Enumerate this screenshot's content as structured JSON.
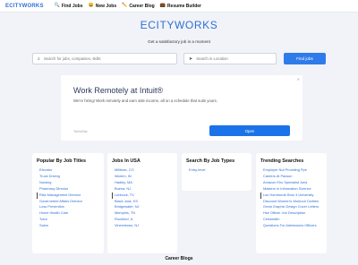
{
  "nav": {
    "logo": "ECITYWORKS",
    "links": [
      {
        "icon": "magnifier-icon",
        "glyph": "🔍",
        "label": "Find Jobs"
      },
      {
        "icon": "new-badge-icon",
        "glyph": "😀",
        "label": "New Jobs"
      },
      {
        "icon": "pencil-icon",
        "glyph": "✏️",
        "label": "Career Blog"
      },
      {
        "icon": "briefcase-icon",
        "glyph": "💼",
        "label": "Resume Builder"
      }
    ]
  },
  "hero": {
    "title": "ECITYWORKS",
    "subtitle": "Get a satisfactory job in a moment"
  },
  "search": {
    "keyword_placeholder": "Search for jobs, companies, skills",
    "location_placeholder": "Search in Location",
    "button_label": "Find jobs"
  },
  "ad": {
    "title": "Work Remotely at Intuit®",
    "text": "We're hiring! Work remotely and earn side income, all on a schedule that suits yours.",
    "brand": "TurboTax",
    "button_label": "Open",
    "close_label": "✕"
  },
  "cards": {
    "popular": {
      "title": "Popular By Job Titles",
      "items": [
        "Elevator",
        "Truck Driving",
        "Nursing",
        "Pharmacy Director",
        "Risk Management Director",
        "Government Affairs Director",
        "Loss Prevention",
        "Home Health Care",
        "Tutor",
        "Salon"
      ]
    },
    "usa": {
      "title": "Jobs In USA",
      "items": [
        "Millbrae, CO",
        "Warren, IN",
        "Hadley, MA",
        "Buena, NJ",
        "Lubbock, TX",
        "Black Jack, KS",
        "Bridgewater, NJ",
        "Memphis, TN",
        "Rockford, IL",
        "Vineentown, NJ"
      ]
    },
    "types": {
      "title": "Search By Job Types",
      "items": [
        "Entry-level"
      ]
    },
    "trending": {
      "title": "Trending Searches",
      "items": [
        "Employer Not Providing Ppe",
        "Careers At Pacsun",
        "Amazon Eho Specialist Jobs",
        "Masters In Information Science",
        "Lsu Homework Bmo 4 University",
        "Discount Women's Workout Clothes",
        "Great Graphic Design Cover Letters",
        "Hse Officer Job Description",
        "Certaxisfin",
        "Questions For Admissions Officers"
      ]
    }
  },
  "footer": {
    "heading": "Career Blogs"
  }
}
